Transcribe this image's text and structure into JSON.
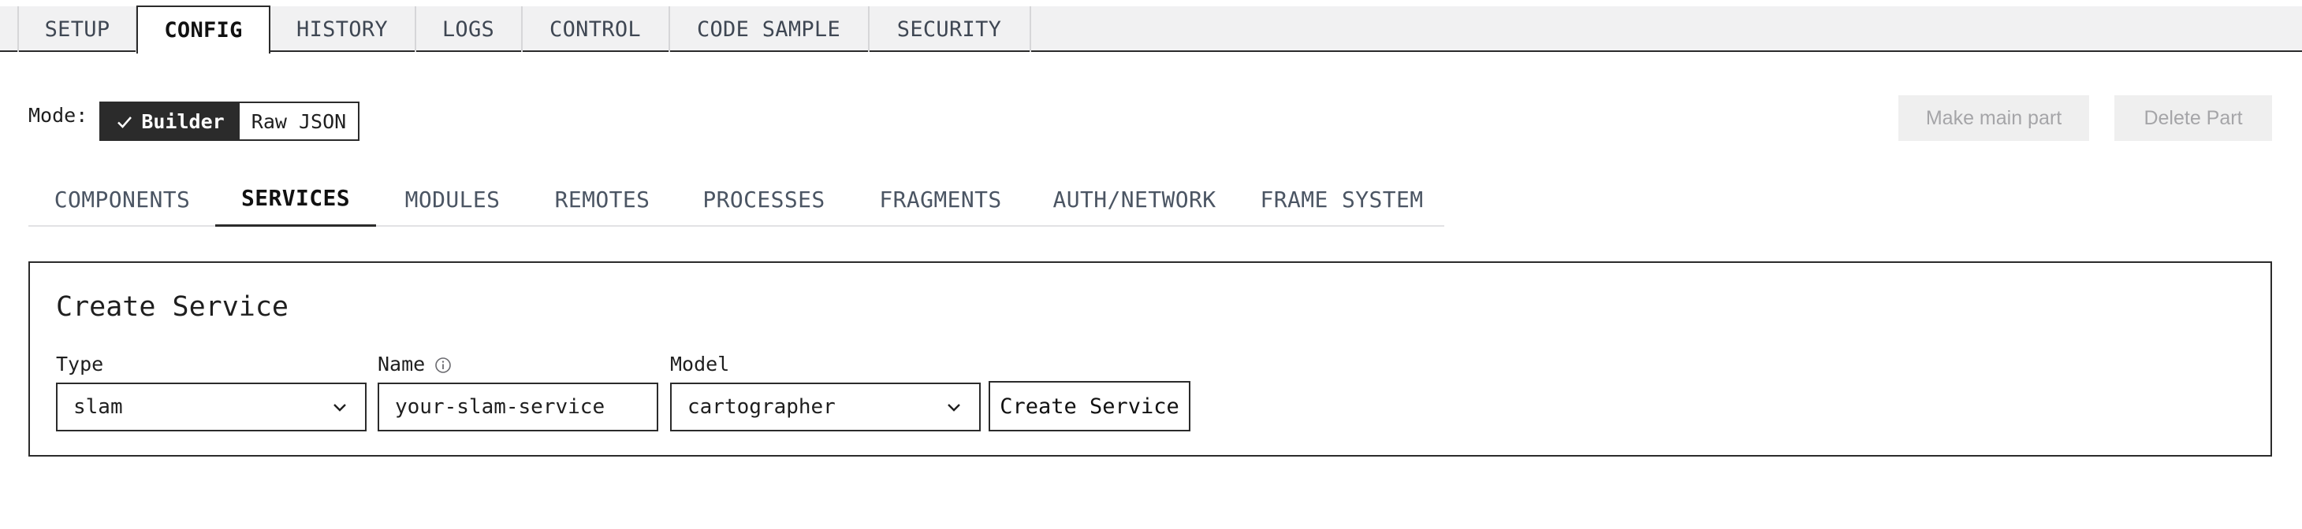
{
  "top_tabs": [
    {
      "label": "SETUP"
    },
    {
      "label": "CONFIG",
      "active": true
    },
    {
      "label": "HISTORY"
    },
    {
      "label": "LOGS"
    },
    {
      "label": "CONTROL"
    },
    {
      "label": "CODE SAMPLE"
    },
    {
      "label": "SECURITY"
    }
  ],
  "mode": {
    "label": "Mode:",
    "options": [
      "Builder",
      "Raw JSON"
    ],
    "selected": "Builder"
  },
  "actions": {
    "make_main_part": "Make main part",
    "delete_part": "Delete Part"
  },
  "sub_tabs": [
    {
      "label": "COMPONENTS"
    },
    {
      "label": "SERVICES",
      "active": true
    },
    {
      "label": "MODULES"
    },
    {
      "label": "REMOTES"
    },
    {
      "label": "PROCESSES"
    },
    {
      "label": "FRAGMENTS"
    },
    {
      "label": "AUTH/NETWORK"
    },
    {
      "label": "FRAME SYSTEM"
    }
  ],
  "create_service": {
    "title": "Create Service",
    "type": {
      "label": "Type",
      "value": "slam"
    },
    "name": {
      "label": "Name",
      "value": "your-slam-service"
    },
    "model": {
      "label": "Model",
      "value": "cartographer"
    },
    "submit_label": "Create Service"
  },
  "colors": {
    "dark": "#2b2b2b",
    "tab_bar_bg": "#f1f1f2",
    "muted_text": "#a5a5a8"
  }
}
